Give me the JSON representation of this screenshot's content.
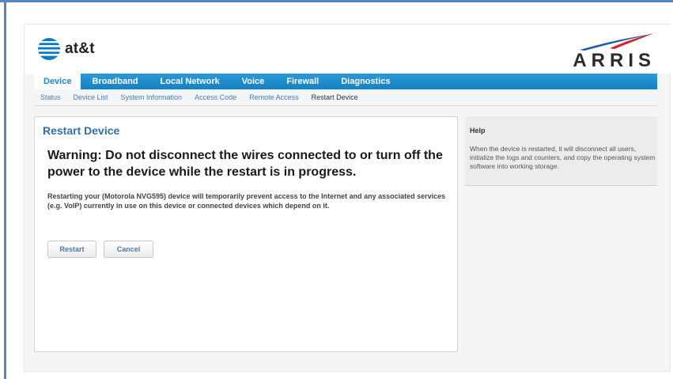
{
  "brand": {
    "att_text": "at&t",
    "arris_text": "ARRIS",
    "colors": {
      "nav_blue": "#1a86c8",
      "title_blue": "#2c6fb0",
      "arris_red": "#d8232a",
      "arris_blue": "#1b5ea8"
    }
  },
  "main_nav": [
    {
      "label": "Device",
      "active": true
    },
    {
      "label": "Broadband"
    },
    {
      "label": "Local Network"
    },
    {
      "label": "Voice"
    },
    {
      "label": "Firewall"
    },
    {
      "label": "Diagnostics"
    }
  ],
  "sub_nav": [
    {
      "label": "Status"
    },
    {
      "label": "Device List"
    },
    {
      "label": "System Information"
    },
    {
      "label": "Access Code"
    },
    {
      "label": "Remote Access"
    },
    {
      "label": "Restart Device",
      "active": true
    }
  ],
  "content": {
    "title": "Restart Device",
    "warning": "Warning: Do not disconnect the wires connected to or turn off the power to the device while the restart is in progress.",
    "info": "Restarting your (Motorola NVG595) device will temporarily prevent access to the Internet and any associated services (e.g. VoIP) currently in use on this device or connected devices which depend on it.",
    "restart_label": "Restart",
    "cancel_label": "Cancel"
  },
  "help": {
    "title": "Help",
    "text": "When the device is restarted, it will disconnect all users, initialize the logs and counters, and copy the operating system software into working storage."
  }
}
